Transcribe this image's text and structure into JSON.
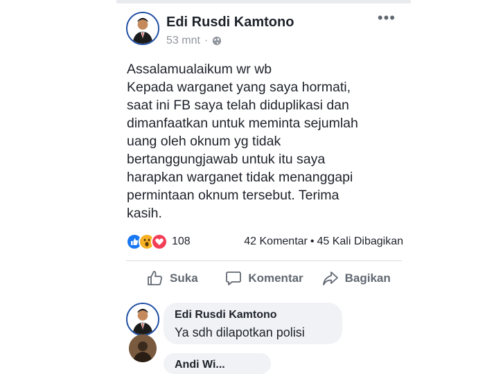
{
  "post": {
    "author": "Edi Rusdi Kamtono",
    "time": "53 mnt",
    "separator": "·",
    "body": "Assalamualaikum wr wb\nKepada warganet yang saya hormati,\nsaat ini FB saya telah diduplikasi dan\ndimanfaatkan untuk meminta sejumlah\nuang oleh oknum yg tidak\nbertanggungjawab  untuk itu saya\nharapkan warganet tidak menanggapi\npermintaan oknum tersebut. Terima\nkasih.",
    "reaction_count": "108",
    "comments_count": "42 Komentar",
    "dot": "•",
    "shares_count": "45 Kali Dibagikan",
    "more_label": "•••"
  },
  "actions": {
    "like": "Suka",
    "comment": "Komentar",
    "share": "Bagikan"
  },
  "comments": [
    {
      "author": "Edi Rusdi Kamtono",
      "text": "Ya sdh dilapotkan polisi"
    },
    {
      "author": "Andi Wi..."
    }
  ],
  "colors": {
    "like_blue": "#1877f2",
    "love_red": "#f33e58",
    "wow_yellow": "#f7b125"
  },
  "icons": {
    "privacy": "globe-icon",
    "like": "thumbs-up-icon",
    "comment": "speech-bubble-icon",
    "share": "share-arrow-icon"
  }
}
